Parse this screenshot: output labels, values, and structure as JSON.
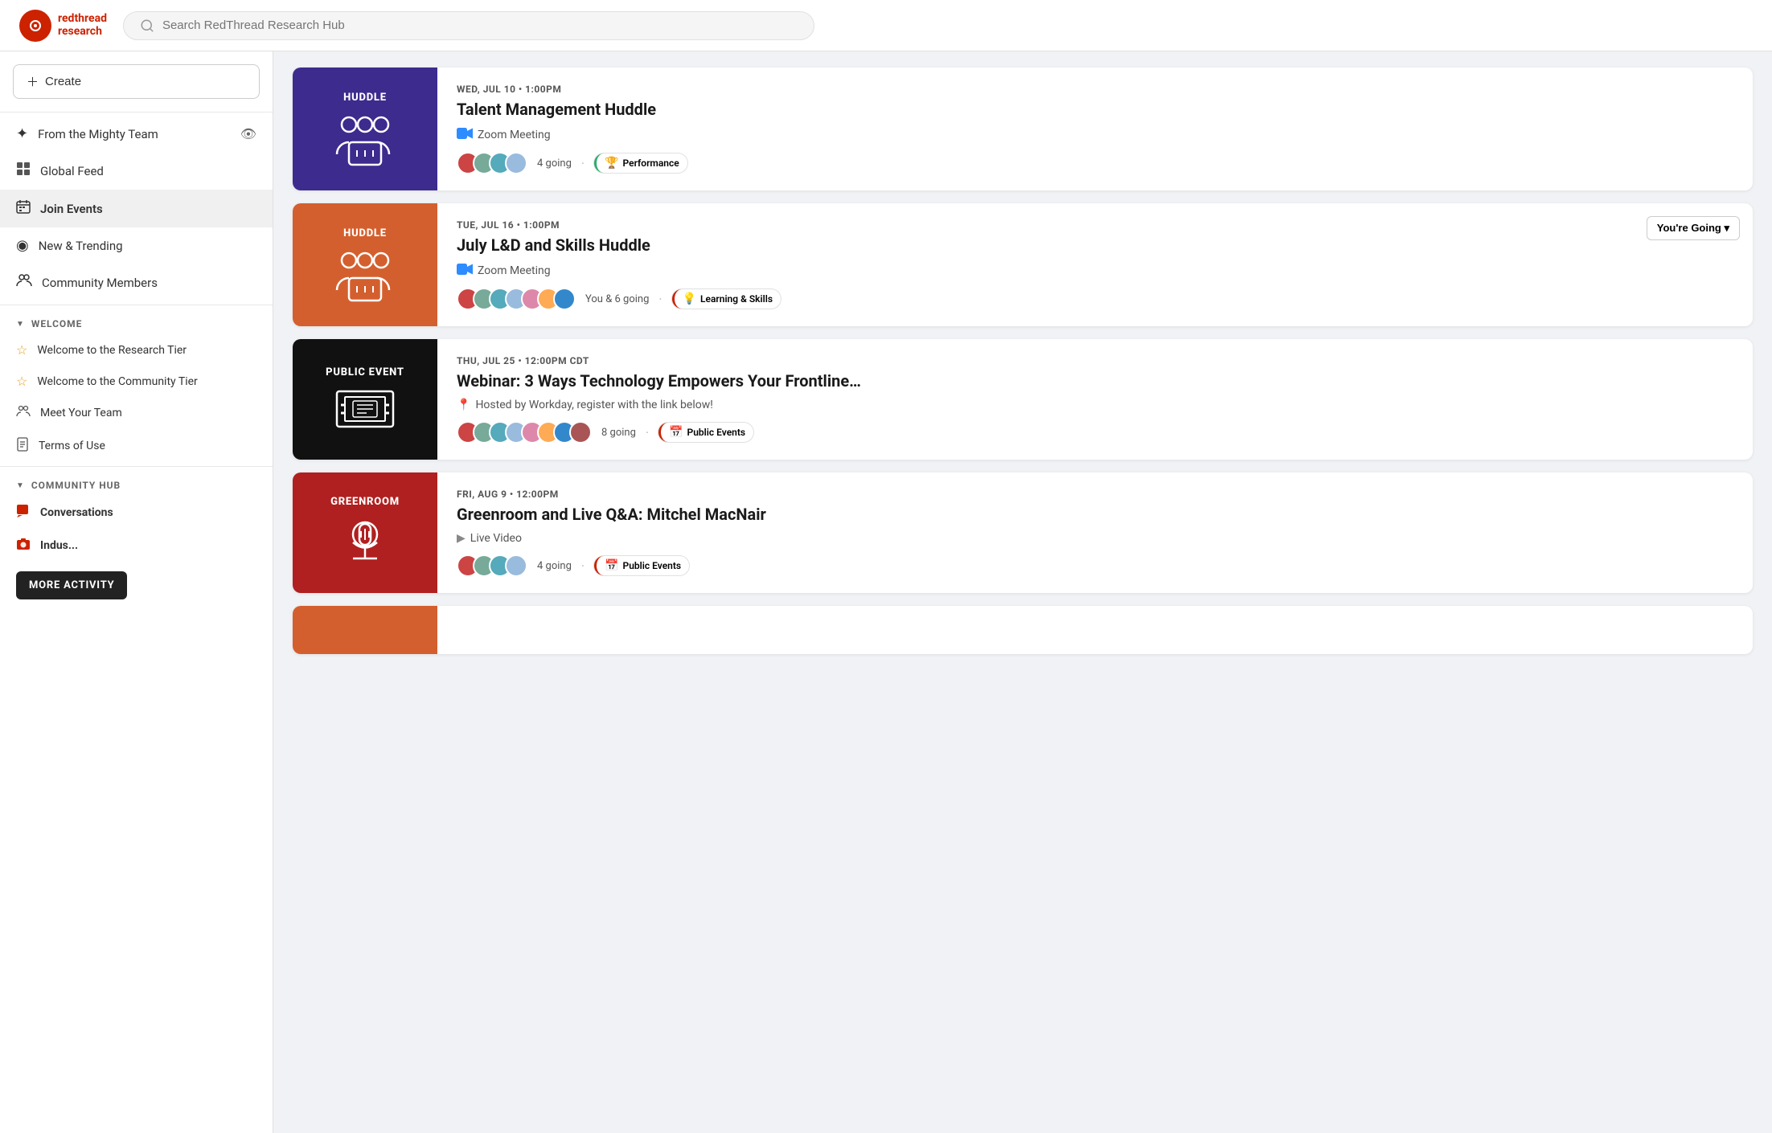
{
  "header": {
    "logo_line1": "redthread",
    "logo_line2": "research",
    "search_placeholder": "Search RedThread Research Hub"
  },
  "sidebar": {
    "create_label": "Create",
    "nav_items": [
      {
        "id": "from-mighty-team",
        "icon": "✦",
        "label": "From the Mighty Team",
        "has_eye": true
      },
      {
        "id": "global-feed",
        "icon": "▦",
        "label": "Global Feed",
        "has_eye": false
      },
      {
        "id": "join-events",
        "icon": "▦",
        "label": "Join Events",
        "active": true
      },
      {
        "id": "new-trending",
        "icon": "◉",
        "label": "New & Trending"
      },
      {
        "id": "community-members",
        "icon": "👥",
        "label": "Community Members"
      }
    ],
    "sections": [
      {
        "id": "welcome",
        "label": "WELCOME",
        "items": [
          {
            "id": "research-tier",
            "icon": "☆",
            "label": "Welcome to the Research Tier"
          },
          {
            "id": "community-tier",
            "icon": "☆",
            "label": "Welcome to the Community Tier"
          },
          {
            "id": "meet-team",
            "icon": "👥",
            "label": "Meet Your Team"
          },
          {
            "id": "terms",
            "icon": "📋",
            "label": "Terms of Use"
          }
        ]
      },
      {
        "id": "community-hub",
        "label": "COMMUNITY HUB",
        "items": [
          {
            "id": "conversations",
            "icon": "💬",
            "label": "Conversations",
            "bold": true
          },
          {
            "id": "industry",
            "icon": "📷",
            "label": "Indus...",
            "bold": true
          }
        ]
      }
    ],
    "more_activity": "MORE ACTIVITY"
  },
  "events": [
    {
      "id": "event-1",
      "thumb_type": "HUDDLE",
      "thumb_color": "purple",
      "date": "WED, JUL 10 • 1:00PM",
      "title": "Talent Management Huddle",
      "meta_icon": "zoom",
      "meta_text": "Zoom Meeting",
      "avatars": [
        "#c44",
        "#7a9",
        "#5ab",
        "#9bd"
      ],
      "going_count": "4 going",
      "tag": "Performance",
      "tag_color": "green",
      "tag_icon": "🏆",
      "you_going": false
    },
    {
      "id": "event-2",
      "thumb_type": "HUDDLE",
      "thumb_color": "orange",
      "date": "TUE, JUL 16 • 1:00PM",
      "title": "July L&D and Skills Huddle",
      "meta_icon": "zoom",
      "meta_text": "Zoom Meeting",
      "avatars": [
        "#c44",
        "#7a9",
        "#5ab",
        "#9bd",
        "#d8a",
        "#fa5",
        "#38c"
      ],
      "going_count": "You & 6 going",
      "tag": "Learning & Skills",
      "tag_color": "red",
      "tag_icon": "💡",
      "you_going": true,
      "you_going_label": "You're Going ▾"
    },
    {
      "id": "event-3",
      "thumb_type": "PUBLIC EVENT",
      "thumb_color": "black",
      "date": "THU, JUL 25 • 12:00PM CDT",
      "title": "Webinar: 3 Ways Technology Empowers Your Frontline…",
      "meta_icon": "location",
      "meta_text": "Hosted by Workday, register with the link below!",
      "avatars": [
        "#c44",
        "#7a9",
        "#5ab",
        "#9bd",
        "#d8a",
        "#fa5",
        "#38c",
        "#a55"
      ],
      "going_count": "8 going",
      "tag": "Public Events",
      "tag_color": "red",
      "tag_icon": "📅",
      "you_going": false
    },
    {
      "id": "event-4",
      "thumb_type": "GREENROOM",
      "thumb_color": "red",
      "date": "FRI, AUG 9 • 12:00PM",
      "title": "Greenroom and Live Q&A: Mitchel MacNair",
      "meta_icon": "play",
      "meta_text": "Live Video",
      "avatars": [
        "#c44",
        "#7a9",
        "#5ab",
        "#9bd"
      ],
      "going_count": "4 going",
      "tag": "Public Events",
      "tag_color": "red",
      "tag_icon": "📅",
      "you_going": false
    }
  ]
}
